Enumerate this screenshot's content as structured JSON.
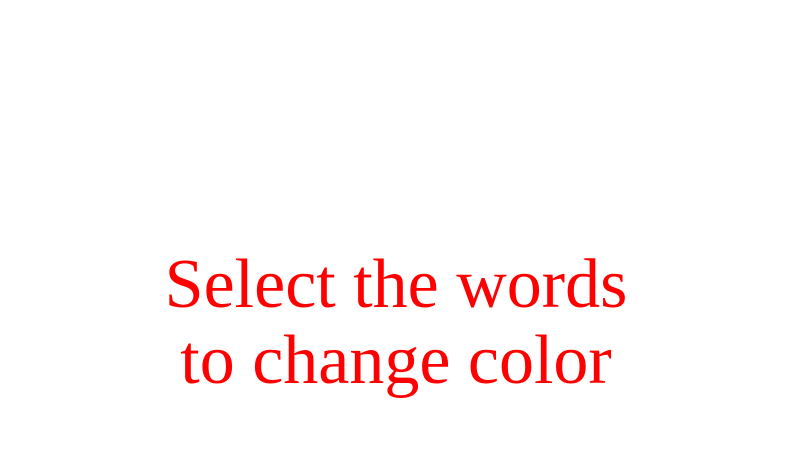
{
  "instruction": {
    "line1": "Select the words",
    "line2": "to change color",
    "color": "#ff0000"
  },
  "background_color": "#ffffff"
}
